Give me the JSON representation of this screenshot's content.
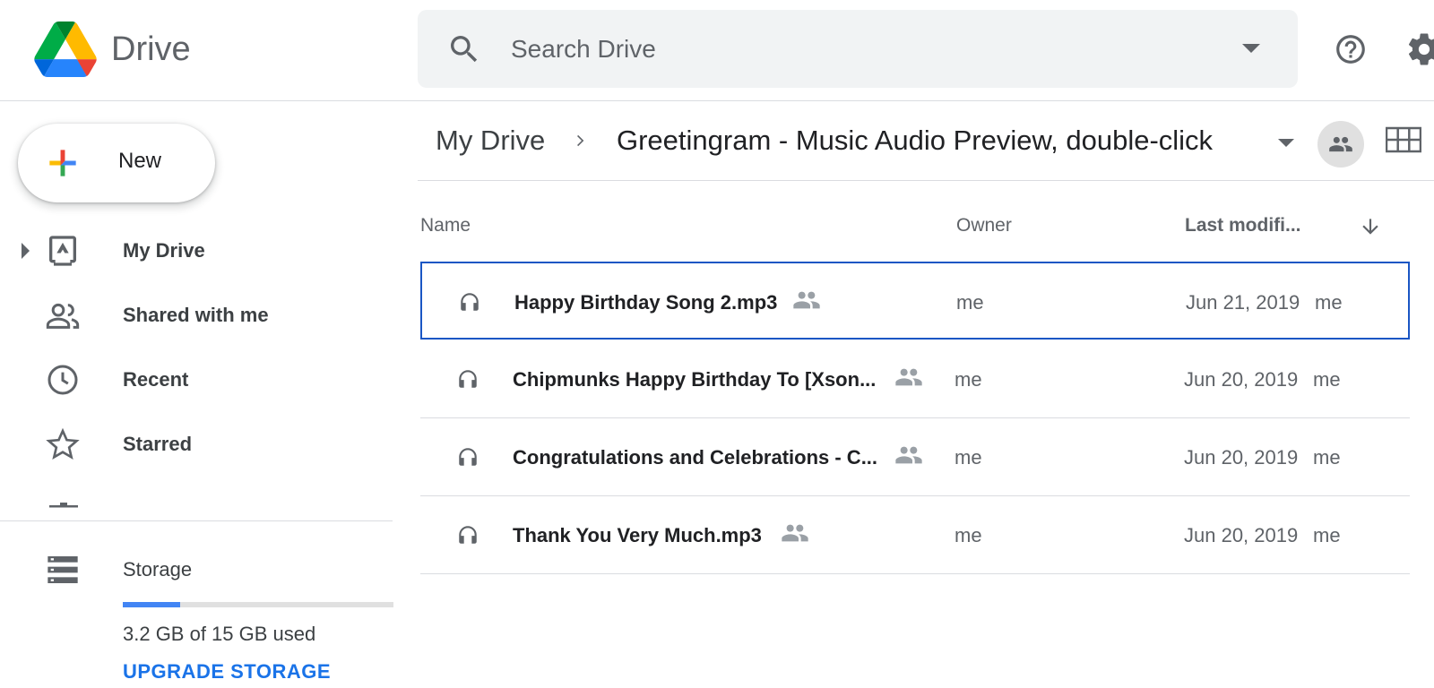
{
  "app": {
    "brand": "Drive",
    "colors": {
      "blue": "#4285f4",
      "green": "#0f9d58",
      "yellow": "#f4b400",
      "red": "#db4437",
      "link": "#1a73e8"
    }
  },
  "search": {
    "placeholder": "Search Drive",
    "value": ""
  },
  "header_icons": [
    "search-icon",
    "help-icon",
    "gear-icon"
  ],
  "new_button": {
    "label": "New"
  },
  "sidebar": {
    "items": [
      {
        "label": "My Drive",
        "icon": "my-drive-icon"
      },
      {
        "label": "Shared with me",
        "icon": "people-icon"
      },
      {
        "label": "Recent",
        "icon": "clock-icon"
      },
      {
        "label": "Starred",
        "icon": "star-icon"
      }
    ],
    "storage": {
      "label": "Storage",
      "used_text": "3.2 GB of 15 GB used",
      "used_fraction": 0.2133,
      "upgrade_label": "UPGRADE STORAGE"
    }
  },
  "breadcrumb": {
    "root": "My Drive",
    "current": "Greetingram - Music Audio Preview, double-click"
  },
  "columns": {
    "name": "Name",
    "owner": "Owner",
    "modified": "Last modifi..."
  },
  "files": [
    {
      "name": "Happy Birthday Song 2.mp3",
      "owner": "me",
      "modified": "Jun 21, 2019",
      "modified_by": "me",
      "selected": true
    },
    {
      "name": "Chipmunks Happy Birthday To [Xson...",
      "owner": "me",
      "modified": "Jun 20, 2019",
      "modified_by": "me",
      "selected": false
    },
    {
      "name": "Congratulations and Celebrations - C...",
      "owner": "me",
      "modified": "Jun 20, 2019",
      "modified_by": "me",
      "selected": false
    },
    {
      "name": "Thank You Very Much.mp3",
      "owner": "me",
      "modified": "Jun 20, 2019",
      "modified_by": "me",
      "selected": false
    }
  ]
}
